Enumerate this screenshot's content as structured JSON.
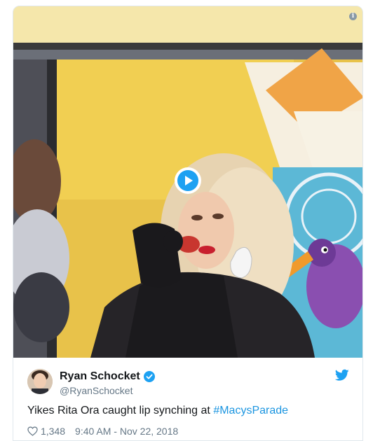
{
  "media": {
    "info_icon": "info-icon",
    "play_icon": "play-icon"
  },
  "tweet": {
    "author_name": "Ryan Schocket",
    "author_handle": "@RyanSchocket",
    "text_prefix": "Yikes Rita Ora caught lip synching at ",
    "hashtag": "#MacysParade",
    "likes": "1,348",
    "time": "9:40 AM",
    "separator": " - ",
    "date": "Nov 22, 2018"
  },
  "colors": {
    "twitter_blue": "#1da1f2",
    "link_blue": "#1b95e0",
    "text_primary": "#14171a",
    "text_secondary": "#657786"
  }
}
